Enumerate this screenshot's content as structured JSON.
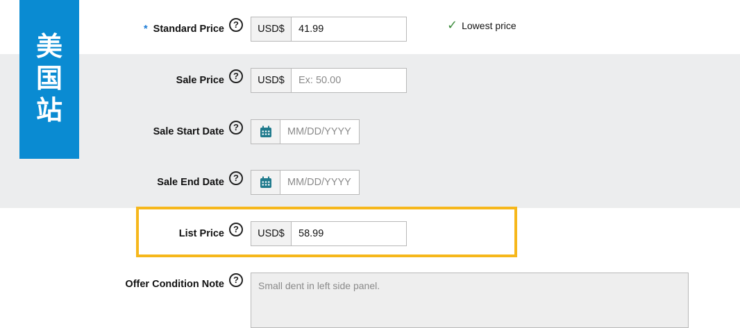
{
  "badge": {
    "chars": [
      "美",
      "国",
      "站"
    ]
  },
  "fields": {
    "standard_price": {
      "required_mark": "*",
      "label": "Standard Price",
      "prefix": "USD$",
      "value": "41.99",
      "status": "Lowest price"
    },
    "sale_price": {
      "label": "Sale Price",
      "prefix": "USD$",
      "placeholder": "Ex: 50.00"
    },
    "sale_start_date": {
      "label": "Sale Start Date",
      "placeholder": "MM/DD/YYYY"
    },
    "sale_end_date": {
      "label": "Sale End Date",
      "placeholder": "MM/DD/YYYY"
    },
    "list_price": {
      "label": "List Price",
      "prefix": "USD$",
      "value": "58.99"
    },
    "offer_condition_note": {
      "label": "Offer Condition Note",
      "placeholder": "Small dent in left side panel."
    }
  },
  "help_glyph": "?",
  "colors": {
    "badge": "#0a8bd2",
    "highlight": "#f6b71b",
    "check": "#3d8c3d",
    "gray_band": "#ecedee"
  },
  "icons": {
    "help": "question-circle-icon",
    "calendar": "calendar-icon",
    "check": "checkmark-icon"
  }
}
